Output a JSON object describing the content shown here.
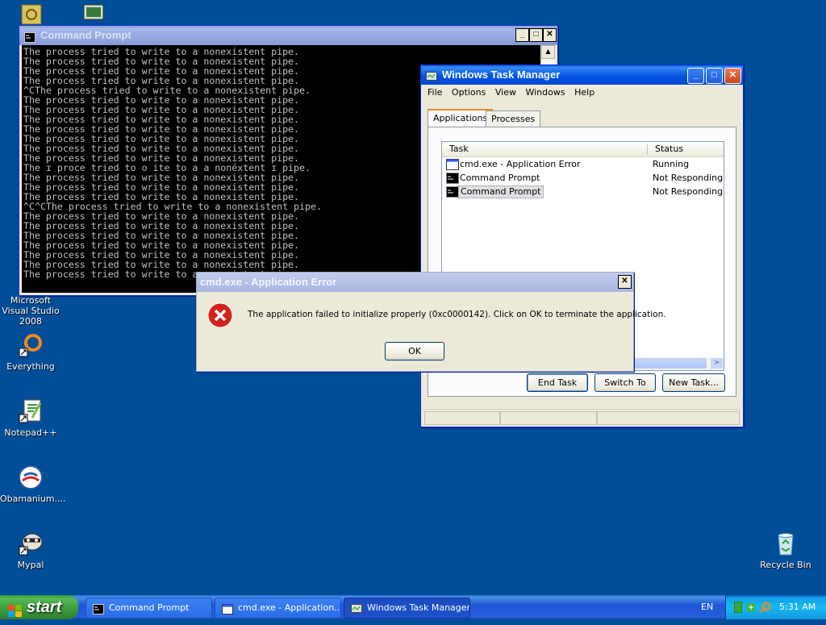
{
  "desktop": {
    "icons": [
      {
        "label": "Microsoft Visual Studio 2008"
      },
      {
        "label": "Everything"
      },
      {
        "label": "Notepad++"
      },
      {
        "label": "Obamanium...."
      },
      {
        "label": "Mypal"
      },
      {
        "label": "Recycle Bin"
      }
    ]
  },
  "cmd_window": {
    "title": "Command Prompt",
    "lines": [
      "The process tried to write to a nonexistent pipe.",
      "The process tried to write to a nonexistent pipe.",
      "The process tried to write to a nonexistent pipe.",
      "The process tried to write to a nonexistent pipe.",
      "^CThe process tried to write to a nonexistent pipe.",
      "The process tried to write to a nonexistent pipe.",
      "The process tried to write to a nonexistent pipe.",
      "The process tried to write to a nonexistent pipe.",
      "The process tried to write to a nonexistent pipe.",
      "The process tried to write to a nonexistent pipe.",
      "The process tried to write to a nonexistent pipe.",
      "The process tried to write to a nonexistent pipe.",
      "The ɪ proce tried to ᴏ ite to a a nonéxtent ɪ pipe.",
      "The process tried to write to a nonexistent pipe.",
      "The process tried to write to a nonexistent pipe.",
      "The process tried to write to a nonexistent pipe.",
      "^C^CThe process tried to write to a nonexistent pipe.",
      "The process tried to write to a nonexistent pipe.",
      "The process tried to write to a nonexistent pipe.",
      "The process tried to write to a nonexistent pipe.",
      "The process tried to write to a nonexistent pipe.",
      "The process tried to write to a nonexistent pipe.",
      "The process tried to write to a nonexistent pipe.",
      "The process tried to write to a nonexistent pipe."
    ]
  },
  "task_manager": {
    "title": "Windows Task Manager",
    "menu": [
      "File",
      "Options",
      "View",
      "Windows",
      "Help"
    ],
    "tabs": [
      "Applications",
      "Processes"
    ],
    "columns": {
      "task": "Task",
      "status": "Status"
    },
    "rows": [
      {
        "task": "cmd.exe - Application Error",
        "status": "Running"
      },
      {
        "task": "Command Prompt",
        "status": "Not Responding"
      },
      {
        "task": "Command Prompt",
        "status": "Not Responding"
      }
    ],
    "buttons": {
      "end_task": "End Task",
      "switch_to": "Switch To",
      "new_task": "New Task..."
    }
  },
  "error_dialog": {
    "title": "cmd.exe - Application Error",
    "message": "The application failed to initialize properly (0xc0000142). Click on OK to terminate the application.",
    "ok": "OK"
  },
  "taskbar": {
    "start": "start",
    "buttons": [
      {
        "label": "Command Prompt"
      },
      {
        "label": "cmd.exe - Application..."
      },
      {
        "label": "Windows Task Manager"
      }
    ],
    "language": "EN",
    "clock": "5:31 AM"
  },
  "colors": {
    "desktop": "#004e98",
    "titlebar": "#0054e3",
    "error_red": "#d4221c"
  }
}
